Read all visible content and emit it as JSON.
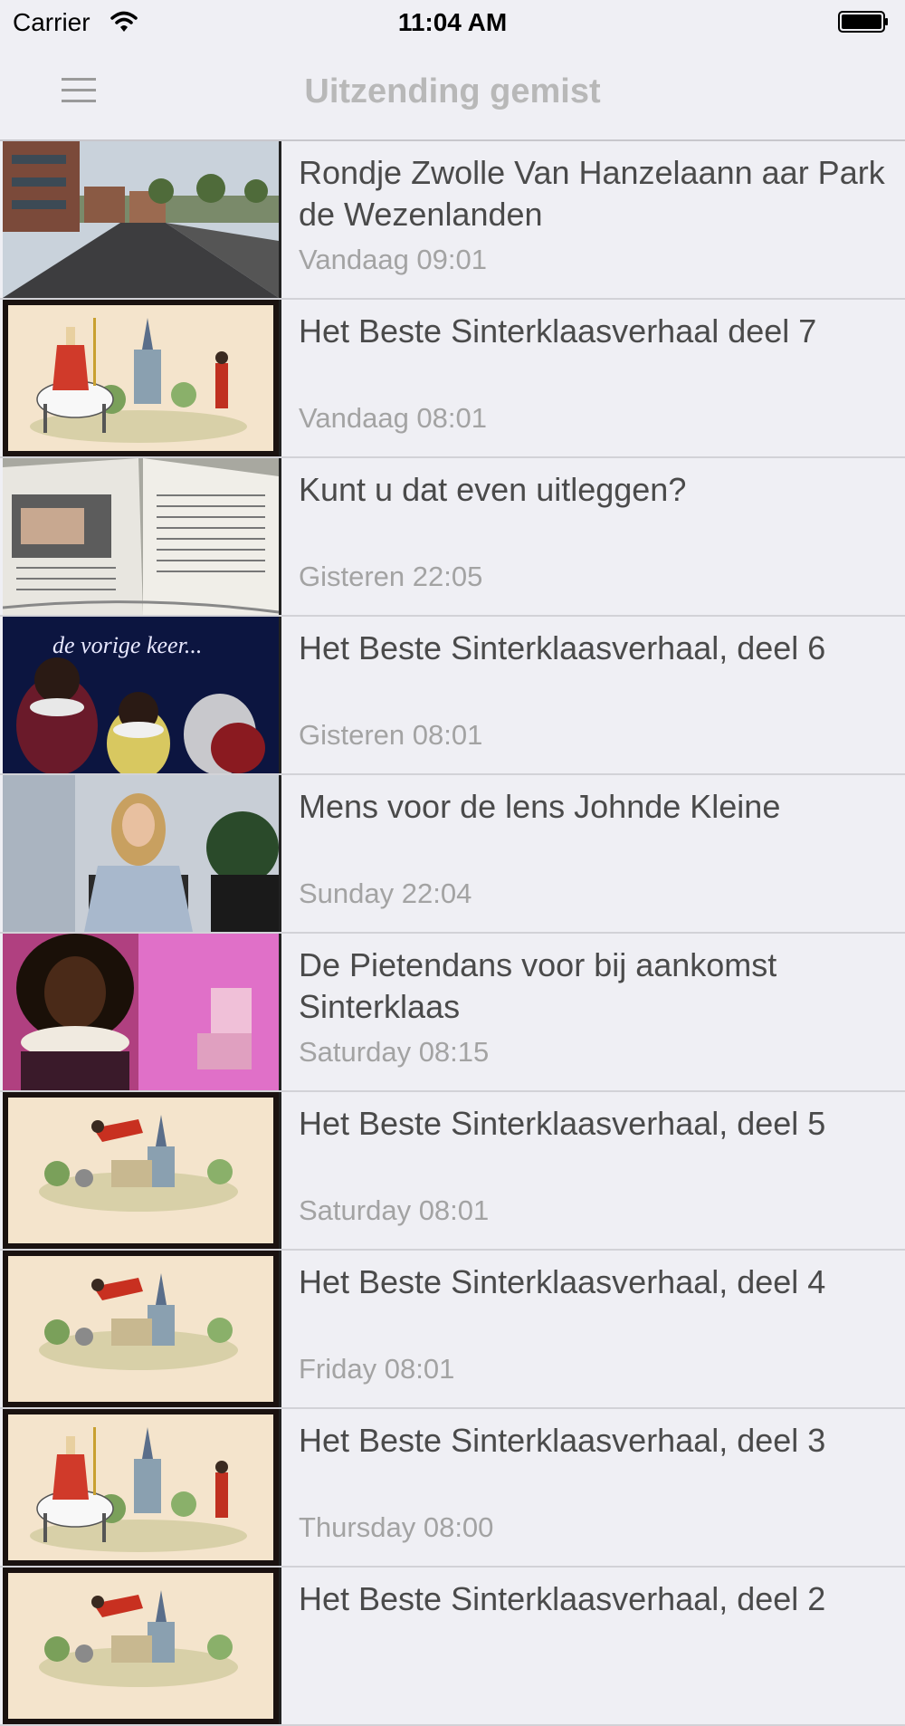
{
  "status": {
    "carrier": "Carrier",
    "time": "11:04 AM"
  },
  "nav": {
    "title": "Uitzending gemist",
    "menu_icon": "hamburger-menu-icon"
  },
  "items": [
    {
      "title": "Rondje Zwolle Van Hanzelaann aar Park de Wezenlanden",
      "date": "Vandaag 09:01",
      "thumb": "street"
    },
    {
      "title": "Het Beste Sinterklaasverhaal deel 7",
      "date": "Vandaag 08:01",
      "thumb": "sint-drawing"
    },
    {
      "title": "Kunt u dat even uitleggen?",
      "date": "Gisteren 22:05",
      "thumb": "book"
    },
    {
      "title": "Het Beste Sinterklaasverhaal, deel 6",
      "date": "Gisteren 08:01",
      "thumb": "dark-scene",
      "thumb_text": "de vorige keer..."
    },
    {
      "title": "Mens voor de lens Johnde Kleine",
      "date": "Sunday 22:04",
      "thumb": "interview"
    },
    {
      "title": "De Pietendans voor bij aankomst Sinterklaas",
      "date": "Saturday 08:15",
      "thumb": "piet"
    },
    {
      "title": "Het Beste Sinterklaasverhaal, deel 5",
      "date": "Saturday 08:01",
      "thumb": "piet-drawing"
    },
    {
      "title": "Het Beste Sinterklaasverhaal, deel 4",
      "date": "Friday 08:01",
      "thumb": "piet-drawing"
    },
    {
      "title": "Het Beste Sinterklaasverhaal, deel 3",
      "date": "Thursday 08:00",
      "thumb": "sint-drawing"
    },
    {
      "title": "Het Beste Sinterklaasverhaal, deel 2",
      "date": "",
      "thumb": "piet-drawing"
    }
  ]
}
